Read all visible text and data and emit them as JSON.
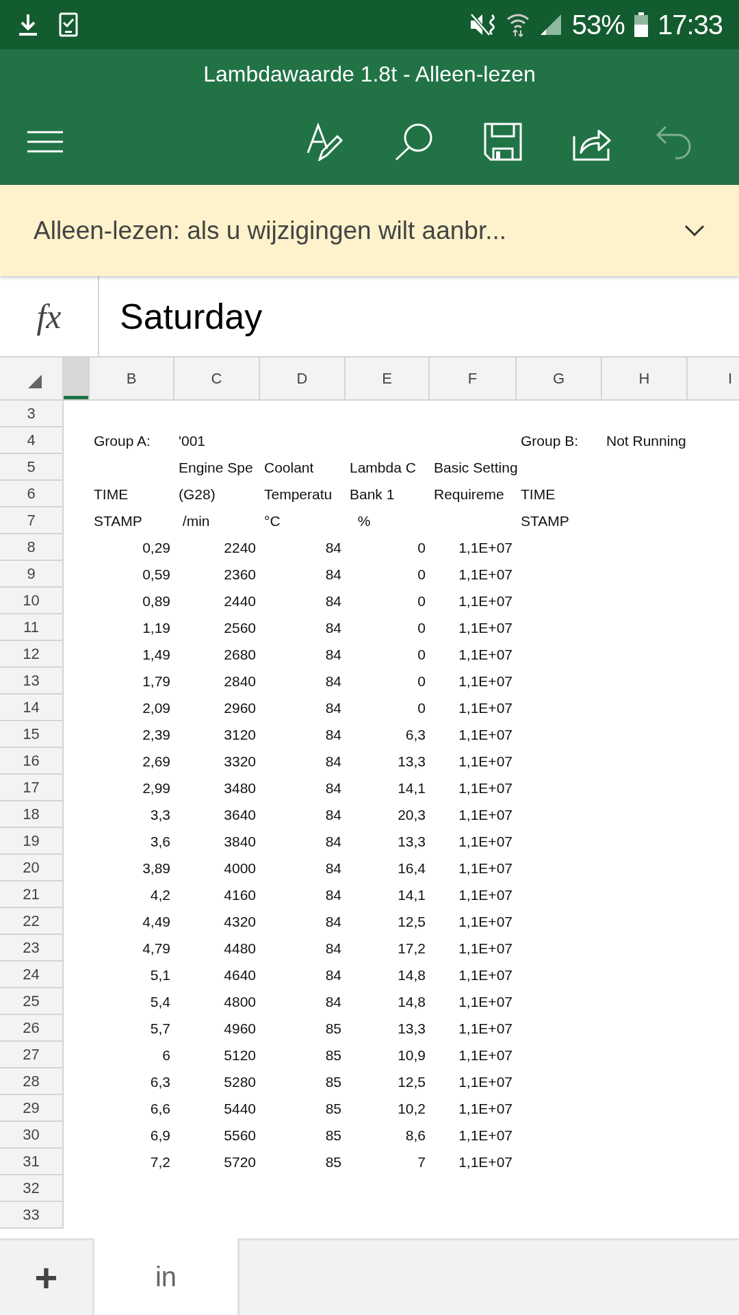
{
  "status_bar": {
    "battery": "53%",
    "time": "17:33"
  },
  "window": {
    "title": "Lambdawaarde 1.8t - Alleen-lezen"
  },
  "toolbar": [
    {
      "kind": "menu",
      "disabled": false
    },
    {
      "kind": "draw",
      "disabled": false
    },
    {
      "kind": "search",
      "disabled": false
    },
    {
      "kind": "save",
      "disabled": false
    },
    {
      "kind": "share",
      "disabled": false
    },
    {
      "kind": "undo",
      "disabled": true
    }
  ],
  "banner": {
    "text": "Alleen-lezen: als u wijzigingen wilt aanbr..."
  },
  "formula_bar": {
    "label": "fx",
    "value": "Saturday"
  },
  "sheet": {
    "columns": [
      {
        "selected": true
      },
      {
        "label": "B",
        "selected": false
      },
      {
        "label": "C",
        "selected": false
      },
      {
        "label": "D",
        "selected": false
      },
      {
        "label": "E",
        "selected": false
      },
      {
        "label": "F",
        "selected": false
      },
      {
        "label": "G",
        "selected": false
      },
      {
        "label": "H",
        "selected": false
      },
      {
        "label": "I",
        "selected": false
      }
    ],
    "rows": [
      {
        "number": "3",
        "kind": "text"
      },
      {
        "number": "4",
        "kind": "text",
        "cells": [
          "",
          "Group A:",
          "'001",
          "",
          "",
          "",
          "Group B:",
          "Not Running"
        ]
      },
      {
        "number": "5",
        "kind": "text",
        "cells": [
          "",
          "",
          "Engine Spe",
          "Coolant",
          "Lambda C",
          "Basic Setting"
        ]
      },
      {
        "number": "6",
        "kind": "text",
        "cells": [
          "",
          "TIME",
          "(G28)",
          "Temperatu",
          "Bank 1",
          "Requireme",
          "TIME"
        ]
      },
      {
        "number": "7",
        "kind": "text",
        "cells": [
          "",
          "STAMP",
          " /min",
          "°C",
          "  %",
          "",
          "STAMP"
        ]
      },
      {
        "number": "8",
        "kind": "number",
        "cells": [
          "",
          "0,29",
          "2240",
          "84",
          "0",
          "1,1E+07"
        ]
      },
      {
        "number": "9",
        "kind": "number",
        "cells": [
          "",
          "0,59",
          "2360",
          "84",
          "0",
          "1,1E+07"
        ]
      },
      {
        "number": "10",
        "kind": "number",
        "cells": [
          "",
          "0,89",
          "2440",
          "84",
          "0",
          "1,1E+07"
        ]
      },
      {
        "number": "11",
        "kind": "number",
        "cells": [
          "",
          "1,19",
          "2560",
          "84",
          "0",
          "1,1E+07"
        ]
      },
      {
        "number": "12",
        "kind": "number",
        "cells": [
          "",
          "1,49",
          "2680",
          "84",
          "0",
          "1,1E+07"
        ]
      },
      {
        "number": "13",
        "kind": "number",
        "cells": [
          "",
          "1,79",
          "2840",
          "84",
          "0",
          "1,1E+07"
        ]
      },
      {
        "number": "14",
        "kind": "number",
        "cells": [
          "",
          "2,09",
          "2960",
          "84",
          "0",
          "1,1E+07"
        ]
      },
      {
        "number": "15",
        "kind": "number",
        "cells": [
          "",
          "2,39",
          "3120",
          "84",
          "6,3",
          "1,1E+07"
        ]
      },
      {
        "number": "16",
        "kind": "number",
        "cells": [
          "",
          "2,69",
          "3320",
          "84",
          "13,3",
          "1,1E+07"
        ]
      },
      {
        "number": "17",
        "kind": "number",
        "cells": [
          "",
          "2,99",
          "3480",
          "84",
          "14,1",
          "1,1E+07"
        ]
      },
      {
        "number": "18",
        "kind": "number",
        "cells": [
          "",
          "3,3",
          "3640",
          "84",
          "20,3",
          "1,1E+07"
        ]
      },
      {
        "number": "19",
        "kind": "number",
        "cells": [
          "",
          "3,6",
          "3840",
          "84",
          "13,3",
          "1,1E+07"
        ]
      },
      {
        "number": "20",
        "kind": "number",
        "cells": [
          "",
          "3,89",
          "4000",
          "84",
          "16,4",
          "1,1E+07"
        ]
      },
      {
        "number": "21",
        "kind": "number",
        "cells": [
          "",
          "4,2",
          "4160",
          "84",
          "14,1",
          "1,1E+07"
        ]
      },
      {
        "number": "22",
        "kind": "number",
        "cells": [
          "",
          "4,49",
          "4320",
          "84",
          "12,5",
          "1,1E+07"
        ]
      },
      {
        "number": "23",
        "kind": "number",
        "cells": [
          "",
          "4,79",
          "4480",
          "84",
          "17,2",
          "1,1E+07"
        ]
      },
      {
        "number": "24",
        "kind": "number",
        "cells": [
          "",
          "5,1",
          "4640",
          "84",
          "14,8",
          "1,1E+07"
        ]
      },
      {
        "number": "25",
        "kind": "number",
        "cells": [
          "",
          "5,4",
          "4800",
          "84",
          "14,8",
          "1,1E+07"
        ]
      },
      {
        "number": "26",
        "kind": "number",
        "cells": [
          "",
          "5,7",
          "4960",
          "85",
          "13,3",
          "1,1E+07"
        ]
      },
      {
        "number": "27",
        "kind": "number",
        "cells": [
          "",
          "6",
          "5120",
          "85",
          "10,9",
          "1,1E+07"
        ]
      },
      {
        "number": "28",
        "kind": "number",
        "cells": [
          "",
          "6,3",
          "5280",
          "85",
          "12,5",
          "1,1E+07"
        ]
      },
      {
        "number": "29",
        "kind": "number",
        "cells": [
          "",
          "6,6",
          "5440",
          "85",
          "10,2",
          "1,1E+07"
        ]
      },
      {
        "number": "30",
        "kind": "number",
        "cells": [
          "",
          "6,9",
          "5560",
          "85",
          "8,6",
          "1,1E+07"
        ]
      },
      {
        "number": "31",
        "kind": "number",
        "cells": [
          "",
          "7,2",
          "5720",
          "85",
          "7",
          "1,1E+07"
        ]
      },
      {
        "number": "32",
        "kind": "text"
      },
      {
        "number": "33",
        "kind": "text"
      }
    ]
  },
  "sheet_tabs": {
    "add_label": "+",
    "tabs": [
      {
        "label": "in",
        "selected": true
      }
    ]
  }
}
